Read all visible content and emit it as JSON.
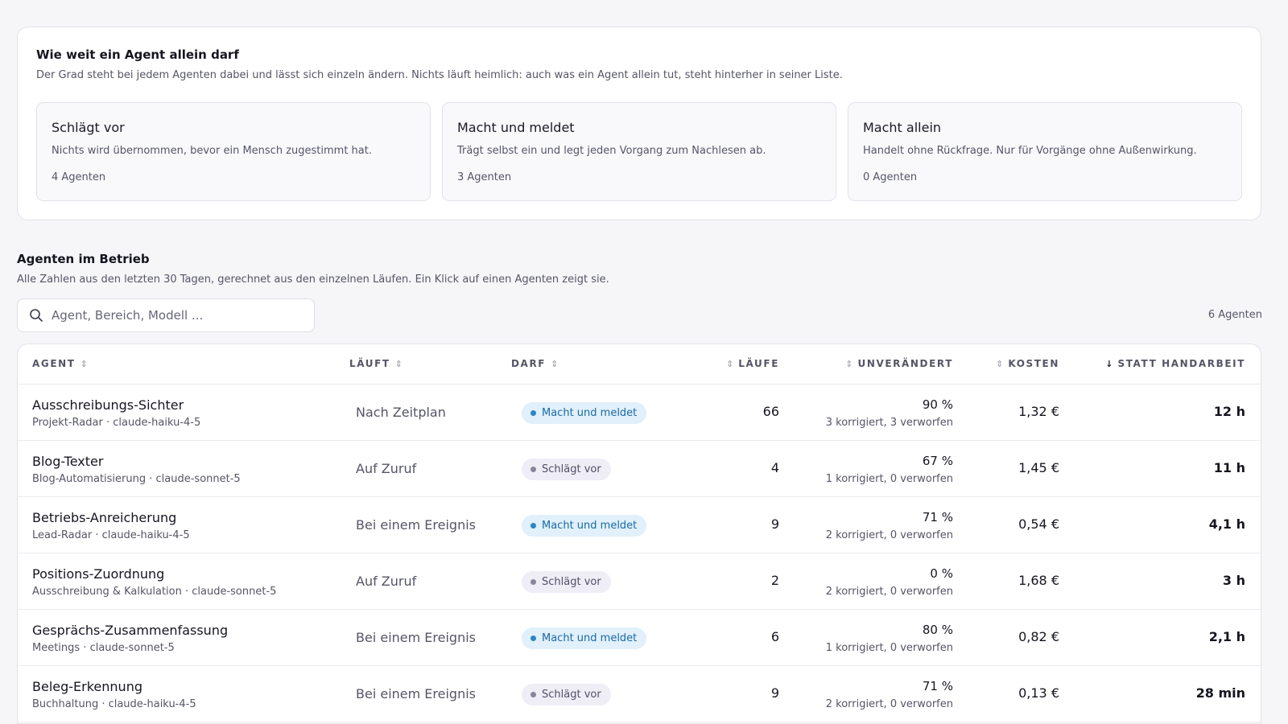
{
  "autonomy": {
    "title": "Wie weit ein Agent allein darf",
    "description": "Der Grad steht bei jedem Agenten dabei und lässt sich einzeln ändern. Nichts läuft heimlich: auch was ein Agent allein tut, steht hinterher in seiner Liste.",
    "levels": [
      {
        "title": "Schlägt vor",
        "description": "Nichts wird übernommen, bevor ein Mensch zugestimmt hat.",
        "count": "4 Agenten"
      },
      {
        "title": "Macht und meldet",
        "description": "Trägt selbst ein und legt jeden Vorgang zum Nachlesen ab.",
        "count": "3 Agenten"
      },
      {
        "title": "Macht allein",
        "description": "Handelt ohne Rückfrage. Nur für Vorgänge ohne Außenwirkung.",
        "count": "0 Agenten"
      }
    ]
  },
  "agents_section": {
    "title": "Agenten im Betrieb",
    "description": "Alle Zahlen aus den letzten 30 Tagen, gerechnet aus den einzelnen Läufen. Ein Klick auf einen Agenten zeigt sie.",
    "search_placeholder": "Agent, Bereich, Modell ...",
    "search_value": "",
    "count": "6 Agenten"
  },
  "table": {
    "headers": {
      "agent": "AGENT",
      "trigger": "LÄUFT",
      "permission": "DARF",
      "runs": "LÄUFE",
      "unchanged": "UNVERÄNDERT",
      "cost": "KOSTEN",
      "saved": "STATT HANDARBEIT"
    },
    "sort_icons": {
      "inactive": "⇕",
      "active_desc": "↓"
    },
    "colors": {
      "badge_blue": "#2a86c8",
      "badge_gray": "#8a8598"
    },
    "rows": [
      {
        "name": "Ausschreibungs-Sichter",
        "meta": "Projekt-Radar · claude-haiku-4-5",
        "trigger": "Nach Zeitplan",
        "badge": "Macht und meldet",
        "badge_color": "blue",
        "runs": "66",
        "pct": "90 %",
        "corrections": "3 korrigiert, 3 verworfen",
        "cost": "1,32 €",
        "saved": "12 h"
      },
      {
        "name": "Blog-Texter",
        "meta": "Blog-Automatisierung · claude-sonnet-5",
        "trigger": "Auf Zuruf",
        "badge": "Schlägt vor",
        "badge_color": "gray",
        "runs": "4",
        "pct": "67 %",
        "corrections": "1 korrigiert, 0 verworfen",
        "cost": "1,45 €",
        "saved": "11 h"
      },
      {
        "name": "Betriebs-Anreicherung",
        "meta": "Lead-Radar · claude-haiku-4-5",
        "trigger": "Bei einem Ereignis",
        "badge": "Macht und meldet",
        "badge_color": "blue",
        "runs": "9",
        "pct": "71 %",
        "corrections": "2 korrigiert, 0 verworfen",
        "cost": "0,54 €",
        "saved": "4,1 h"
      },
      {
        "name": "Positions-Zuordnung",
        "meta": "Ausschreibung & Kalkulation · claude-sonnet-5",
        "trigger": "Auf Zuruf",
        "badge": "Schlägt vor",
        "badge_color": "gray",
        "runs": "2",
        "pct": "0 %",
        "corrections": "2 korrigiert, 0 verworfen",
        "cost": "1,68 €",
        "saved": "3 h"
      },
      {
        "name": "Gesprächs-Zusammenfassung",
        "meta": "Meetings · claude-sonnet-5",
        "trigger": "Bei einem Ereignis",
        "badge": "Macht und meldet",
        "badge_color": "blue",
        "runs": "6",
        "pct": "80 %",
        "corrections": "1 korrigiert, 0 verworfen",
        "cost": "0,82 €",
        "saved": "2,1 h"
      },
      {
        "name": "Beleg-Erkennung",
        "meta": "Buchhaltung · claude-haiku-4-5",
        "trigger": "Bei einem Ereignis",
        "badge": "Schlägt vor",
        "badge_color": "gray",
        "runs": "9",
        "pct": "71 %",
        "corrections": "2 korrigiert, 0 verworfen",
        "cost": "0,13 €",
        "saved": "28 min"
      }
    ]
  }
}
